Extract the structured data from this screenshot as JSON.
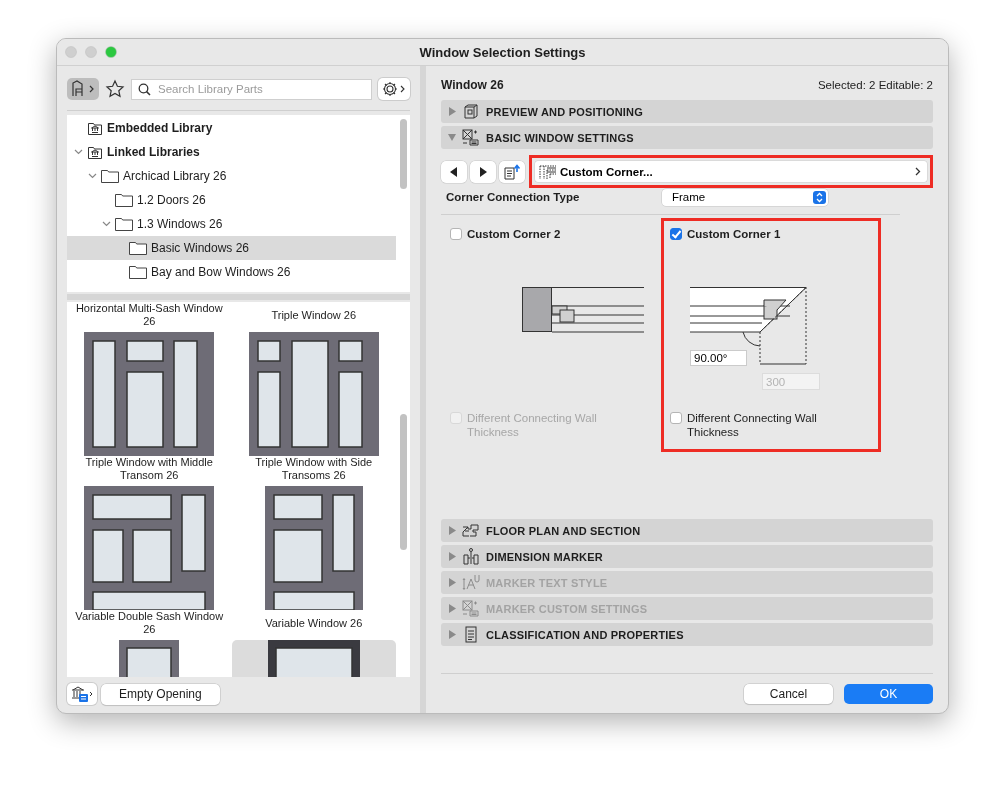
{
  "window": {
    "title": "Window Selection Settings"
  },
  "library": {
    "search": {
      "placeholder": "Search Library Parts"
    },
    "tree": [
      {
        "label": "Embedded Library",
        "kind": "library",
        "expanded": false,
        "selected": false
      },
      {
        "label": "Linked Libraries",
        "kind": "library",
        "expanded": true,
        "selected": false,
        "children": [
          {
            "label": "Archicad Library 26",
            "kind": "folder",
            "expanded": true,
            "selected": false,
            "children": [
              {
                "label": "1.2 Doors 26",
                "kind": "folder",
                "expanded": false,
                "selected": false
              },
              {
                "label": "1.3 Windows 26",
                "kind": "folder",
                "expanded": true,
                "selected": false,
                "children": [
                  {
                    "label": "Basic Windows 26",
                    "kind": "folder",
                    "expanded": false,
                    "selected": true
                  },
                  {
                    "label": "Bay and Bow Windows 26",
                    "kind": "folder",
                    "expanded": false,
                    "selected": false
                  }
                ]
              }
            ]
          }
        ]
      }
    ],
    "parts": [
      {
        "label": "Horizontal Multi-Sash Window 26",
        "selected": false
      },
      {
        "label": "Triple Window 26",
        "selected": false
      },
      {
        "label": "Triple Window with Middle Transom 26",
        "selected": false
      },
      {
        "label": "Triple Window with Side Transoms 26",
        "selected": false
      },
      {
        "label": "Variable Double Sash Window 26",
        "selected": false
      },
      {
        "label": "Variable Window 26",
        "selected": false
      },
      {
        "selected": false
      },
      {
        "selected": true
      }
    ],
    "empty_opening_button": "Empty Opening"
  },
  "settings": {
    "element": "Window 26",
    "selection_info": "Selected: 2 Editable: 2",
    "sections": [
      {
        "title": "PREVIEW AND POSITIONING",
        "expanded": false,
        "disabled": false
      },
      {
        "title": "BASIC WINDOW SETTINGS",
        "expanded": true,
        "disabled": false
      },
      {
        "title": "FLOOR PLAN AND SECTION",
        "expanded": false,
        "disabled": false
      },
      {
        "title": "DIMENSION MARKER",
        "expanded": false,
        "disabled": false
      },
      {
        "title": "MARKER TEXT STYLE",
        "expanded": false,
        "disabled": true
      },
      {
        "title": "MARKER CUSTOM SETTINGS",
        "expanded": false,
        "disabled": true
      },
      {
        "title": "CLASSIFICATION AND PROPERTIES",
        "expanded": false,
        "disabled": false
      }
    ],
    "page_selector": {
      "value": "Custom Corner...",
      "highlighted": true
    },
    "corner_connection": {
      "label": "Corner Connection Type",
      "value": "Frame"
    },
    "corners": [
      {
        "label": "Custom Corner 2",
        "checked": false,
        "highlighted": false,
        "thickness": {
          "label": "Different Connecting Wall Thickness",
          "checked": false,
          "disabled": true
        }
      },
      {
        "label": "Custom Corner 1",
        "checked": true,
        "highlighted": true,
        "angle": "90.00°",
        "distance": "300",
        "distance_disabled": true,
        "thickness": {
          "label": "Different Connecting Wall Thickness",
          "checked": false,
          "disabled": false
        }
      }
    ]
  },
  "buttons": [
    {
      "label": "Cancel",
      "primary": false
    },
    {
      "label": "OK",
      "primary": true
    }
  ]
}
